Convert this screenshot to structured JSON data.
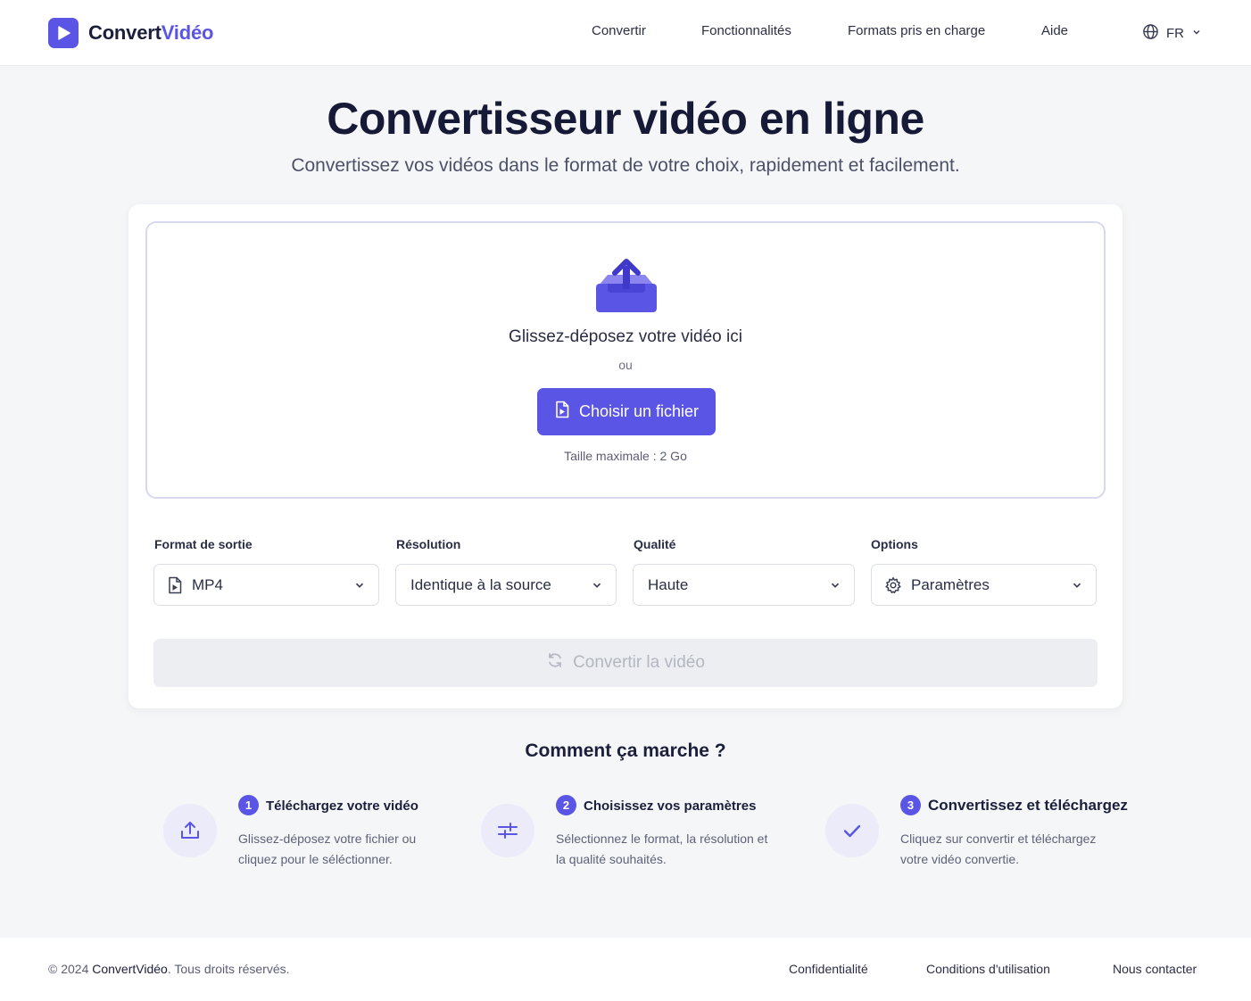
{
  "colors": {
    "accent": "#5b55e6",
    "text": "#1b1f3b",
    "muted": "#5e6278",
    "background": "#f5f6f8",
    "disabled": "#eceef1"
  },
  "header": {
    "logo_part1": "Convert",
    "logo_part2": "Vidéo",
    "nav": [
      {
        "label": "Convertir"
      },
      {
        "label": "Fonctionnalités"
      },
      {
        "label": "Formats pris en charge"
      },
      {
        "label": "Aide"
      }
    ],
    "language": "FR",
    "icons": {
      "logo": "play-icon",
      "language": "globe-icon",
      "dropdown": "chevron-down-icon"
    }
  },
  "hero": {
    "title": "Convertisseur vidéo en ligne",
    "subtitle": "Convertissez vos vidéos dans le format de votre choix, rapidement et facilement."
  },
  "upload": {
    "icon": "upload-box-icon",
    "title": "Glissez-déposez votre vidéo ici",
    "or": "ou",
    "button_label": "Choisir un fichier",
    "button_icon": "file-icon",
    "max_size": "Taille maximale : 2 Go"
  },
  "settings": {
    "format": {
      "label": "Format de sortie",
      "value": "MP4",
      "icon": "file-icon"
    },
    "resolution": {
      "label": "Résolution",
      "value": "Identique à la source"
    },
    "quality": {
      "label": "Qualité",
      "value": "Haute"
    },
    "options": {
      "label": "Options",
      "value": "Paramètres",
      "icon": "gear-icon"
    }
  },
  "convert": {
    "label": "Convertir la vidéo",
    "icon": "refresh-icon",
    "disabled": true
  },
  "how": {
    "title": "Comment ça marche ?",
    "steps": [
      {
        "num": "1",
        "title": "Téléchargez votre vidéo",
        "desc": "Glissez-déposez votre fichier ou cliquez pour le séléctionner.",
        "icon": "upload-icon"
      },
      {
        "num": "2",
        "title": "Choisissez vos paramètres",
        "desc": "Sélectionnez le format, la résolution et la qualité souhaités.",
        "icon": "sliders-icon"
      },
      {
        "num": "3",
        "title": "Convertissez et téléchargez",
        "desc": "Cliquez sur convertir et téléchargez votre vidéo convertie.",
        "icon": "check-icon"
      }
    ]
  },
  "footer": {
    "copyright_prefix": "© 2024",
    "brand": "ConvertVidéo",
    "copyright_suffix": ". Tous droits réservés.",
    "links": [
      {
        "label": "Confidentialité"
      },
      {
        "label": "Conditions d'utilisation"
      },
      {
        "label": "Nous contacter"
      }
    ]
  }
}
